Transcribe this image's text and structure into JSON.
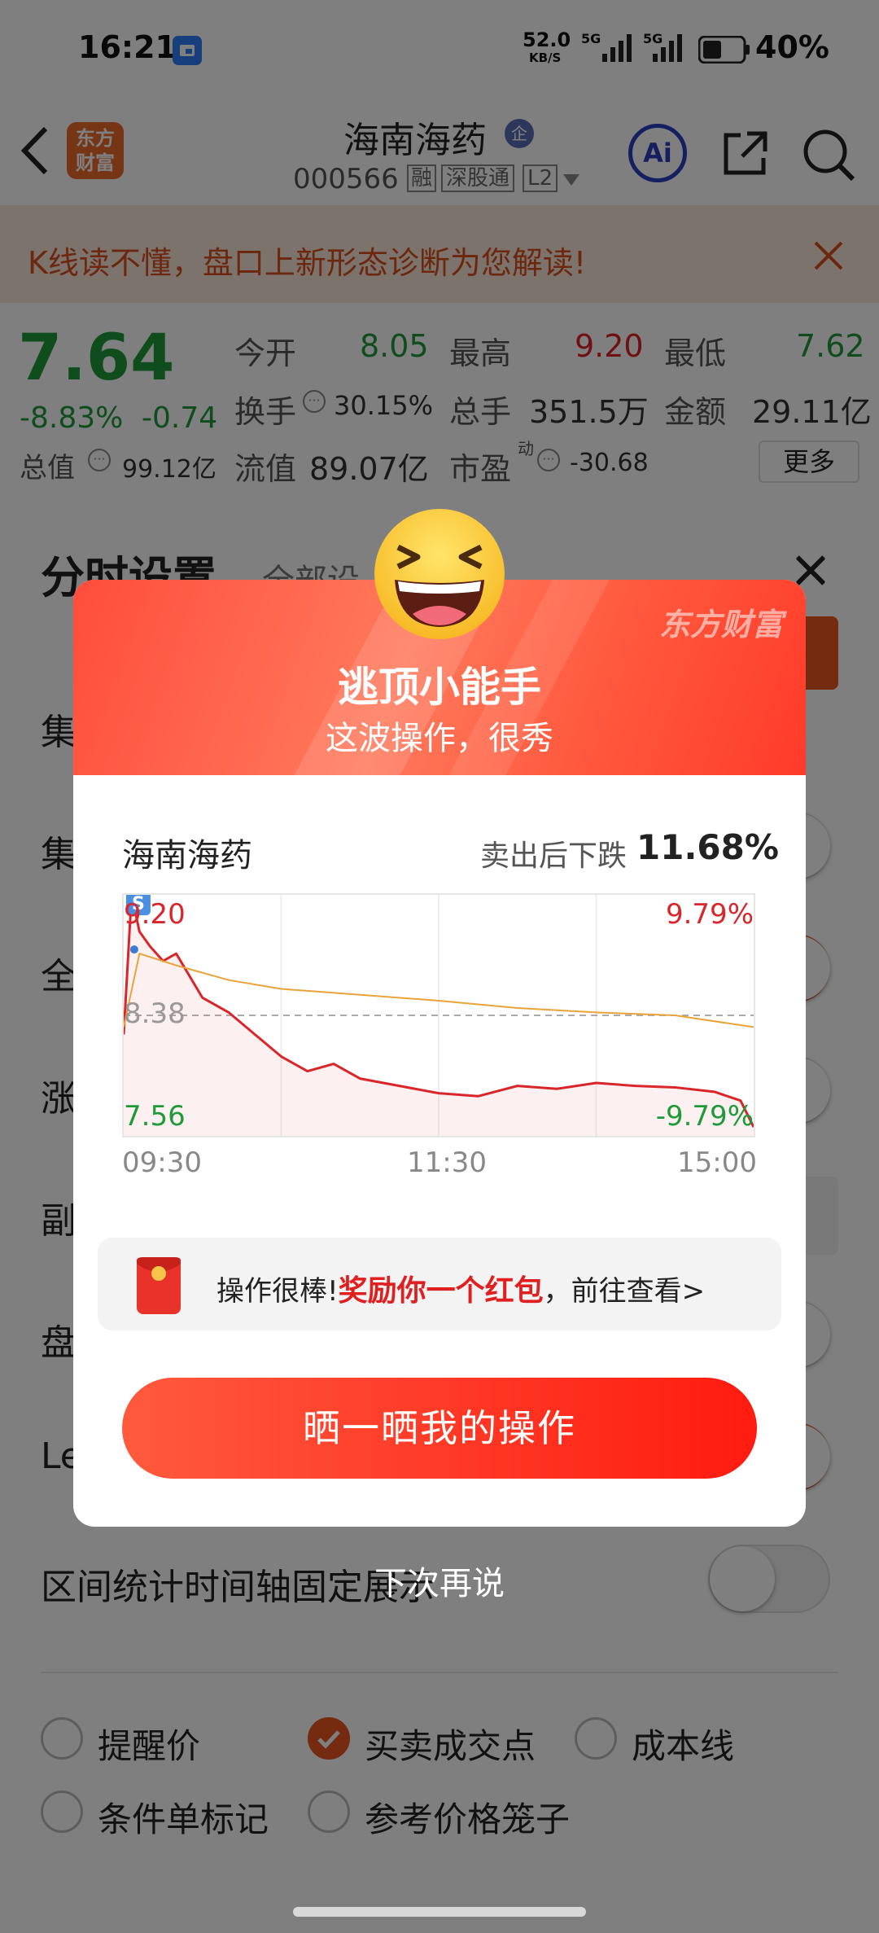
{
  "status": {
    "time": "16:21",
    "speed": "52.0",
    "speed_unit": "KB/S",
    "signal1": "5G",
    "signal2": "5G",
    "battery": "40%"
  },
  "header": {
    "logo_line1": "东方",
    "logo_line2": "财富",
    "title": "海南海药",
    "title_badge": "企",
    "code": "000566",
    "tag1": "融",
    "tag2": "深股通",
    "tag3": "L2",
    "ai_label": "Ai"
  },
  "banner": {
    "text": "K线读不懂，盘口上新形态诊断为您解读!"
  },
  "quote": {
    "price": "7.64",
    "change_pct": "-8.83%",
    "change": "-0.74",
    "open_label": "今开",
    "open": "8.05",
    "high_label": "最高",
    "high": "9.20",
    "low_label": "最低",
    "low": "7.62",
    "turnover_label": "换手",
    "turnover": "30.15%",
    "volume_label": "总手",
    "volume": "351.5万",
    "amount_label": "金额",
    "amount": "29.11亿",
    "mktcap_label": "总值",
    "mktcap": "99.12亿",
    "float_label": "流值",
    "float": "89.07亿",
    "pe_label": "市盈",
    "pe_sup": "动",
    "pe": "-30.68",
    "more": "更多"
  },
  "settings": {
    "title": "分时设置",
    "tab_all": "全部设",
    "rows": [
      "集",
      "集",
      "全",
      "涨",
      "副",
      "盘",
      "Le"
    ],
    "range_row": "区间统计时间轴固定展示",
    "options": [
      {
        "label": "提醒价",
        "checked": false
      },
      {
        "label": "买卖成交点",
        "checked": true
      },
      {
        "label": "成本线",
        "checked": false
      },
      {
        "label": "条件单标记",
        "checked": false
      },
      {
        "label": "参考价格笼子",
        "checked": false
      }
    ]
  },
  "modal": {
    "watermark": "东方财富",
    "title": "逃顶小能手",
    "subtitle": "这波操作，很秀",
    "stock": "海南海药",
    "drop_label": "卖出后下跌",
    "drop_value": "11.68%",
    "reward_prefix": "操作很棒!",
    "reward_highlight": "奖励你一个红包",
    "reward_suffix": "，前往查看>",
    "share_button": "晒一晒我的操作",
    "later": "下次再说"
  },
  "chart_data": {
    "type": "line",
    "title": "",
    "x_labels": [
      "09:30",
      "11:30",
      "15:00"
    ],
    "y_max_label": "9.20",
    "y_mid_label": "8.38",
    "y_min_label": "7.56",
    "pct_max_label": "9.79%",
    "pct_min_label": "-9.79%",
    "ylim": [
      7.56,
      9.2
    ],
    "reference_price": 8.38,
    "sell_marker": {
      "label": "S",
      "time": "09:34",
      "price": 9.05
    },
    "series": [
      {
        "color": "#d9262a",
        "x": [
          "09:30",
          "09:33",
          "09:36",
          "09:40",
          "09:45",
          "09:50",
          "10:00",
          "10:10",
          "10:20",
          "10:30",
          "10:40",
          "10:50",
          "11:00",
          "11:15",
          "11:30",
          "13:15",
          "13:30",
          "13:45",
          "14:00",
          "14:15",
          "14:30",
          "14:45",
          "14:55",
          "15:00"
        ],
        "y": [
          8.25,
          9.2,
          8.95,
          8.85,
          8.75,
          8.8,
          8.5,
          8.4,
          8.25,
          8.1,
          8.0,
          8.05,
          7.95,
          7.9,
          7.85,
          7.83,
          7.9,
          7.88,
          7.92,
          7.9,
          7.89,
          7.86,
          7.8,
          7.62
        ]
      },
      {
        "color": "#e8a43a",
        "x": [
          "09:30",
          "09:36",
          "09:50",
          "10:10",
          "10:30",
          "11:00",
          "11:30",
          "13:30",
          "14:00",
          "14:30",
          "15:00"
        ],
        "y": [
          8.3,
          8.8,
          8.72,
          8.62,
          8.56,
          8.52,
          8.48,
          8.43,
          8.4,
          8.38,
          8.3
        ]
      }
    ]
  },
  "colors": {
    "up": "#e02020",
    "down": "#1f9a3a",
    "accent": "#e8561e"
  }
}
